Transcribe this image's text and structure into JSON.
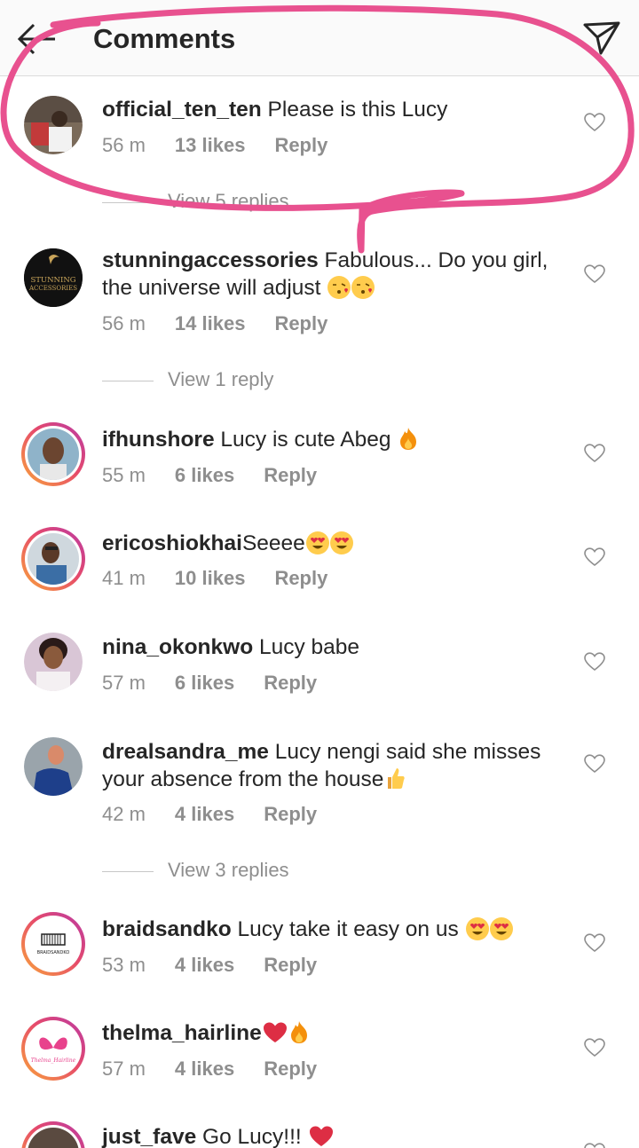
{
  "header": {
    "title": "Comments",
    "back_icon": "arrow-left-icon",
    "send_icon": "paper-plane-icon"
  },
  "colors": {
    "annotation": "#e8518f",
    "meta": "#8e8e8e",
    "text": "#262626",
    "ring_start": "#f9a63a",
    "ring_end": "#b93aa6"
  },
  "comments": [
    {
      "username": "official_ten_ten",
      "text": "Please is this Lucy",
      "time": "56 m",
      "likes": "13 likes",
      "reply": "Reply",
      "view_replies": "View 5 replies"
    },
    {
      "username": "stunningaccessories",
      "text": "Fabulous... Do you girl, the universe will adjust",
      "time": "56 m",
      "likes": "14 likes",
      "reply": "Reply",
      "view_replies": "View 1 reply",
      "avatar_text": "STUNNING ACCESSORIES"
    },
    {
      "username": "ifhunshore",
      "text": "Lucy is cute Abeg",
      "time": "55 m",
      "likes": "6 likes",
      "reply": "Reply"
    },
    {
      "username": "ericoshiokhai",
      "text": "Seeee",
      "time": "41 m",
      "likes": "10 likes",
      "reply": "Reply"
    },
    {
      "username": "nina_okonkwo",
      "text": "Lucy babe",
      "time": "57 m",
      "likes": "6 likes",
      "reply": "Reply"
    },
    {
      "username": "drealsandra_me",
      "text": "Lucy nengi said she misses your absence from the house",
      "time": "42 m",
      "likes": "4 likes",
      "reply": "Reply",
      "view_replies": "View 3 replies"
    },
    {
      "username": "braidsandko",
      "text": "Lucy take it easy on us",
      "time": "53 m",
      "likes": "4 likes",
      "reply": "Reply",
      "avatar_text": "BRAIDSANDKO"
    },
    {
      "username": "thelma_hairline",
      "text": "",
      "time": "57 m",
      "likes": "4 likes",
      "reply": "Reply",
      "avatar_text": "Thelma_Hairline"
    },
    {
      "username": "just_fave",
      "text": "Go Lucy!!!",
      "time": "",
      "likes": "",
      "reply": ""
    }
  ]
}
